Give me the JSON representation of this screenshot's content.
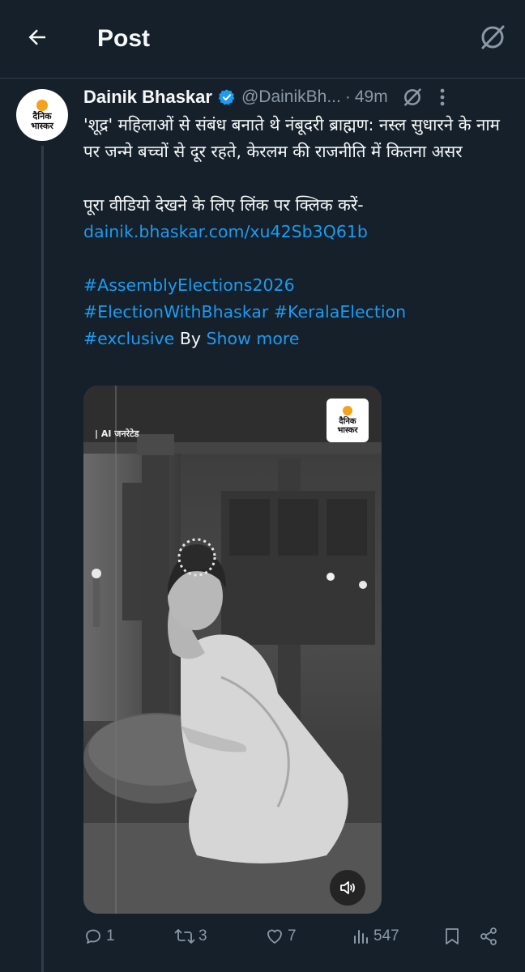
{
  "header": {
    "title": "Post"
  },
  "post": {
    "author": {
      "display_name": "Dainik Bhaskar",
      "handle": "@DainikBh...",
      "logo_line1": "दैनिक",
      "logo_line2": "भास्कर"
    },
    "separator": "·",
    "time": "49m",
    "body": {
      "line_main": "'शूद्र' महिलाओं से संबंध बनाते थे नंबूदरी ब्राह्मण: नस्ल सुधारने के नाम पर जन्मे बच्चों से दूर रहते, केरलम की राजनीति में कितना असर",
      "line_cta": "पूरा वीडियो देखने के लिए लिंक पर क्लिक करें-",
      "link": "dainik.bhaskar.com/xu42Sb3Q61b",
      "hashtag1": "#AssemblyElections2026",
      "hashtag2": "#ElectionWithBhaskar",
      "hashtag3": "#KeralaElection",
      "hashtag4": "#exclusive",
      "by": "By",
      "show_more": "Show more"
    },
    "media": {
      "ai_label": "| AI जनरेटेड",
      "logo_line1": "दैनिक",
      "logo_line2": "भास्कर"
    },
    "actions": {
      "replies": "1",
      "reposts": "3",
      "likes": "7",
      "views": "547"
    }
  },
  "colors": {
    "background": "#15202b",
    "accent": "#1d9bf0",
    "muted": "#8b98a5",
    "text": "#f7f9f9"
  },
  "icons": [
    "back-arrow-icon",
    "grok-icon",
    "verified-badge-icon",
    "more-icon",
    "reply-icon",
    "repost-icon",
    "like-icon",
    "views-icon",
    "bookmark-icon",
    "share-icon",
    "speaker-icon"
  ]
}
